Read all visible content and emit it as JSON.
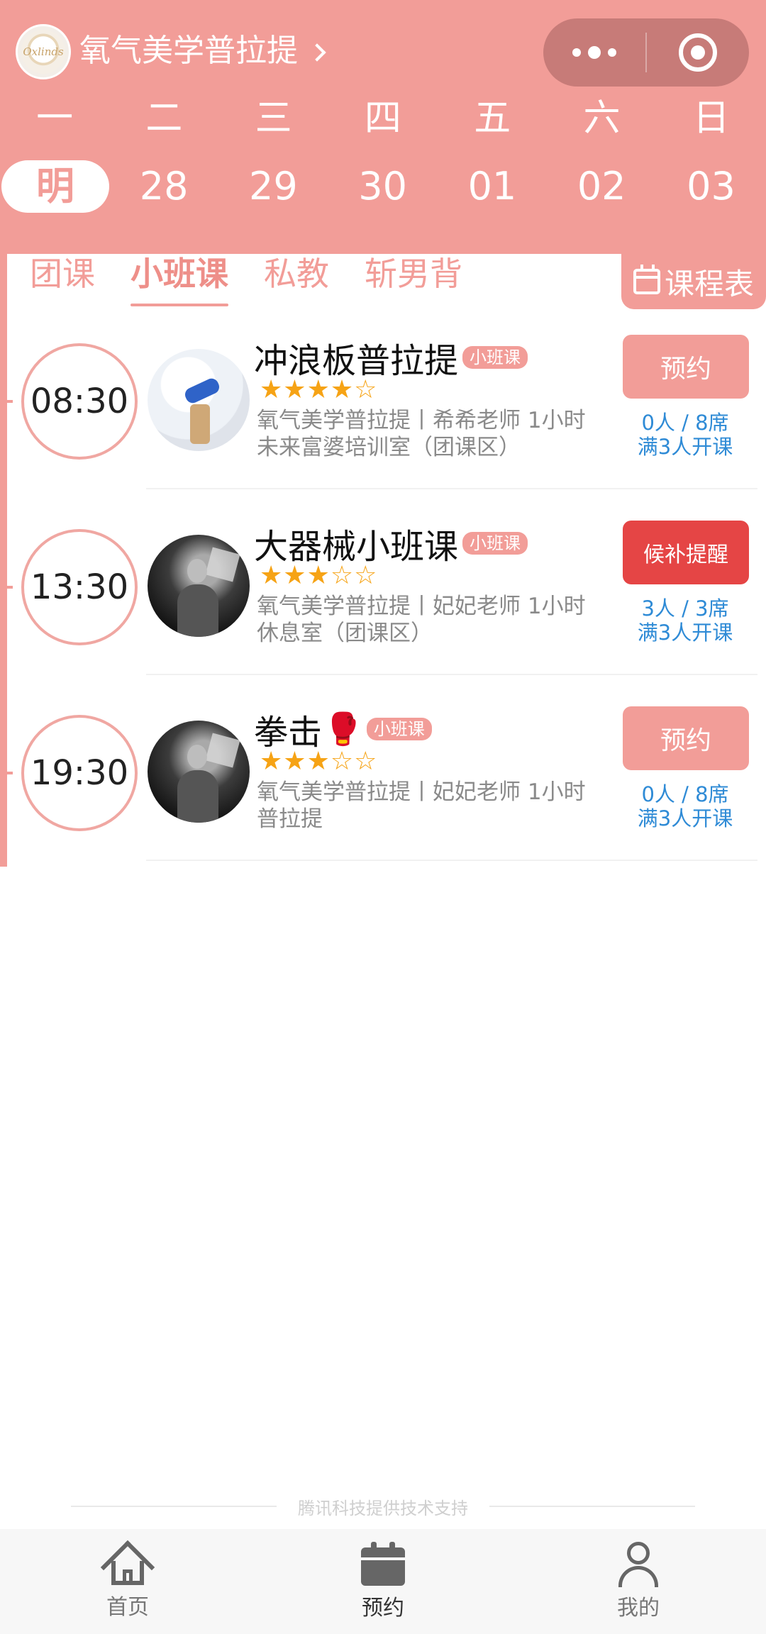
{
  "header": {
    "title": "氧气美学普拉提",
    "logo_text": "Oxlinds",
    "weekdays": [
      "一",
      "二",
      "三",
      "四",
      "五",
      "六",
      "日"
    ],
    "dates": [
      "明",
      "28",
      "29",
      "30",
      "01",
      "02",
      "03"
    ],
    "selected_index": 0
  },
  "tabs": [
    {
      "label": "团课",
      "active": false
    },
    {
      "label": "小班课",
      "active": true
    },
    {
      "label": "私教",
      "active": false
    },
    {
      "label": "斩男背",
      "active": false
    }
  ],
  "schedule_button": "课程表",
  "courses": [
    {
      "time": "08:30",
      "title": "冲浪板普拉提",
      "badge": "小班课",
      "rating": 4,
      "desc_line1": "氧气美学普拉提丨希希老师 1小时",
      "desc_line2": "未来富婆培训室（团课区）",
      "button": "预约",
      "button_type": "book",
      "seats": "0人 / 8席",
      "minimum": "满3人开课",
      "avatar": "light",
      "emoji": ""
    },
    {
      "time": "13:30",
      "title": "大器械小班课",
      "badge": "小班课",
      "rating": 3,
      "desc_line1": "氧气美学普拉提丨妃妃老师 1小时",
      "desc_line2": "休息室（团课区）",
      "button": "候补提醒",
      "button_type": "wait",
      "seats": "3人 / 3席",
      "minimum": "满3人开课",
      "avatar": "dark",
      "emoji": ""
    },
    {
      "time": "19:30",
      "title": "拳击",
      "badge": "小班课",
      "rating": 3,
      "desc_line1": "氧气美学普拉提丨妃妃老师 1小时",
      "desc_line2": "普拉提",
      "button": "预约",
      "button_type": "book",
      "seats": "0人 / 8席",
      "minimum": "满3人开课",
      "avatar": "dark",
      "emoji": "🥊"
    }
  ],
  "powered_by": "腾讯科技提供技术支持",
  "tabbar": [
    {
      "label": "首页",
      "icon": "home-icon",
      "active": false
    },
    {
      "label": "预约",
      "icon": "calendar-icon",
      "active": true
    },
    {
      "label": "我的",
      "icon": "user-icon",
      "active": false
    }
  ],
  "colors": {
    "brand": "#f29d98",
    "waitlist": "#e54545",
    "seat_text": "#2f8bd6",
    "star": "#f6a315"
  }
}
